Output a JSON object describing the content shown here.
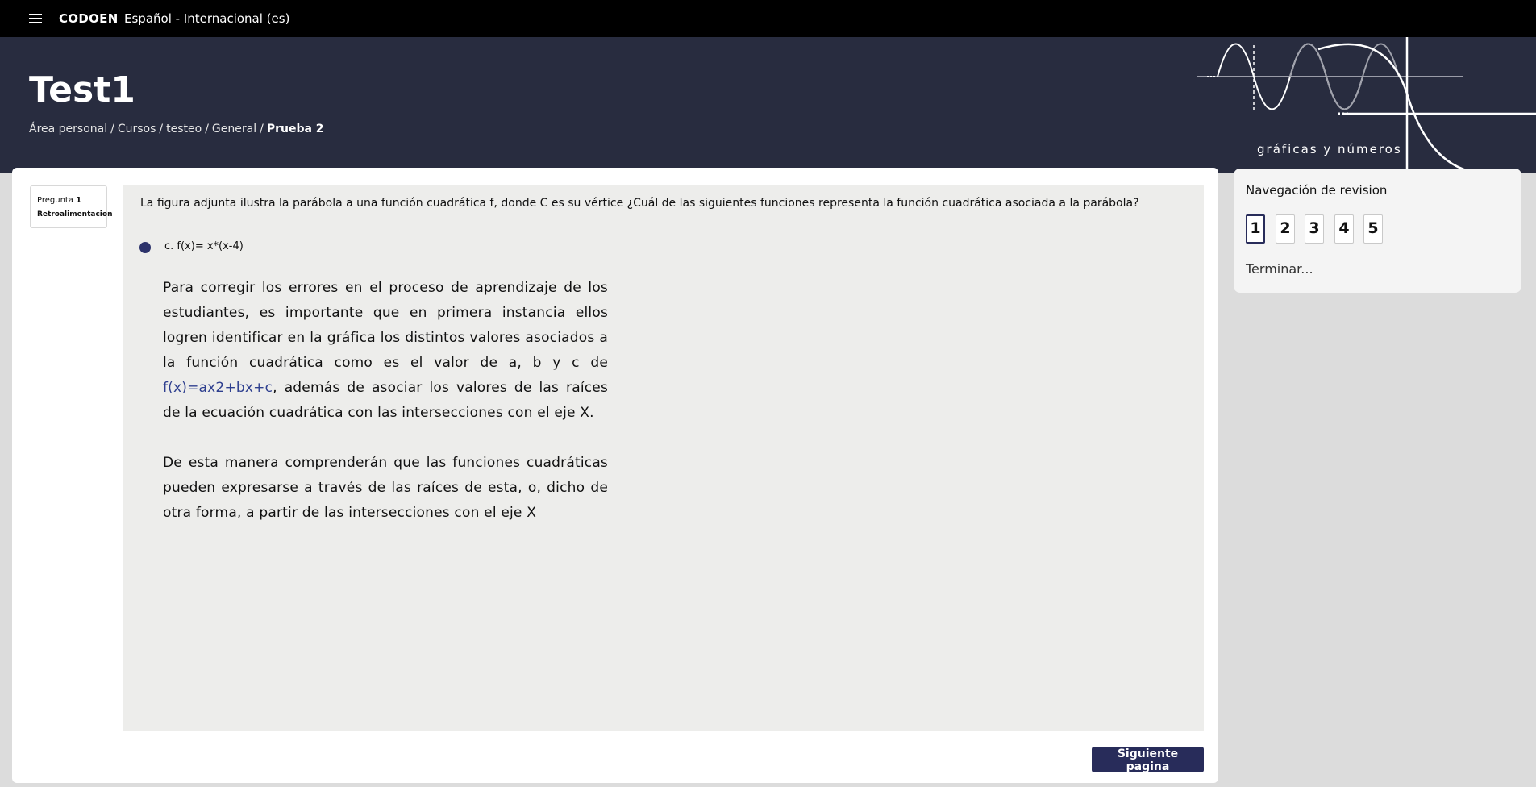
{
  "topbar": {
    "brand": "CODOEN",
    "language": "Español ‎- Internacional ‎(es)‎"
  },
  "header": {
    "title": "Test1",
    "breadcrumb": [
      "Área personal",
      "Cursos",
      "testeo",
      "General"
    ],
    "breadcrumb_current": "Prueba 2",
    "logo_text": "gráficas y números"
  },
  "question": {
    "label": "Pregunta",
    "number": "1",
    "flag": "Retroalimentacion",
    "text": "La figura adjunta ilustra la parábola  a una función cuadrática f, donde C es su vértice ¿Cuál de las siguientes funciones representa la función cuadrática asociada a la parábola?",
    "answer": "c. f(x)= x*(x-4)",
    "feedback_p1_a": "Para corregir los errores en el proceso de aprendizaje de los estudiantes, es importante que en primera instancia ellos logren identificar en la gráfica los distintos valores asociados a la función cuadrática como es el valor de a, b y c de ",
    "feedback_p1_formula": "f(x)=ax2+bx+c",
    "feedback_p1_b": ", además de asociar los valores de las raíces de la ecuación cuadrática con las intersecciones con el eje X.",
    "feedback_p2": "De esta manera comprenderán que las funciones cuadráticas pueden expresarse a través de las raíces de esta, o, dicho de otra forma, a partir de las intersecciones con el eje X"
  },
  "next_button": "Siguiente pagina",
  "navigation": {
    "title": "Navegación de revision",
    "pages": [
      "1",
      "2",
      "3",
      "4",
      "5"
    ],
    "active_page": "1",
    "finish": "Terminar..."
  },
  "colors": {
    "header_bg": "#282c3f",
    "accent": "#282c5a",
    "formula": "#2e3f8f"
  },
  "icons": [
    "menu-icon",
    "radio-selected-icon"
  ]
}
